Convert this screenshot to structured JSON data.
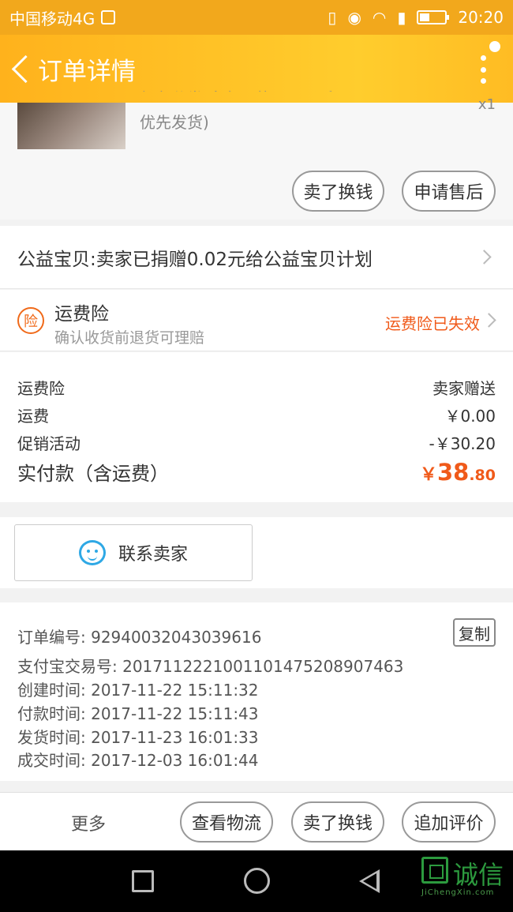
{
  "status_bar": {
    "carrier": "中国移动4G",
    "time": "20:20"
  },
  "nav": {
    "title": "订单详情"
  },
  "goods": {
    "desc_cut": "颜色分类:白色及的号码(预留",
    "desc_line2": "优先发货)",
    "qty": "x1"
  },
  "goods_actions": {
    "sell_label": "卖了换钱",
    "aftersale_label": "申请售后"
  },
  "donation": {
    "text": "公益宝贝:卖家已捐赠0.02元给公益宝贝计划"
  },
  "insurance": {
    "icon_char": "险",
    "title": "运费险",
    "subtitle": "确认收货前退货可理赔",
    "status": "运费险已失效"
  },
  "price_rows": [
    {
      "label": "运费险",
      "value": "卖家赠送"
    },
    {
      "label": "运费",
      "value": "￥0.00"
    },
    {
      "label": "促销活动",
      "value": "-￥30.20"
    }
  ],
  "total": {
    "label": "实付款（含运费）",
    "currency": "￥",
    "int": "38",
    "dec": ".80"
  },
  "contact": {
    "label": "联系卖家"
  },
  "order_info": {
    "order_no": "订单编号: 92940032043039616",
    "alipay_no": "支付宝交易号: 2017112221001101475208907463",
    "created": "创建时间: 2017-11-22 15:11:32",
    "paid": "付款时间: 2017-11-22 15:11:43",
    "shipped": "发货时间: 2017-11-23 16:01:33",
    "completed": "成交时间: 2017-12-03 16:01:44",
    "copy_label": "复制"
  },
  "action_bar": {
    "more_label": "更多",
    "logistics_label": "查看物流",
    "sell_label": "卖了换钱",
    "review_label": "追加评价"
  },
  "watermark": {
    "name": "诚信",
    "url": "JiChengXin.com"
  },
  "colors": {
    "accent": "#f2a81c",
    "price": "#f05a1a",
    "chat_blue": "#2ea8e5"
  }
}
